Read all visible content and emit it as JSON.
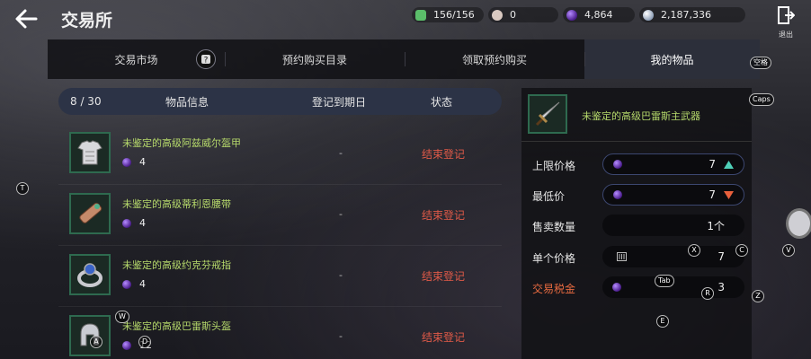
{
  "header": {
    "title": "交易所",
    "exit_label": "退出"
  },
  "currencies": [
    {
      "icon": "weight-icon",
      "value": "156/156",
      "color": "#5bbd6a"
    },
    {
      "icon": "pearl-icon",
      "value": "0",
      "color": "#d9c9c1"
    },
    {
      "icon": "purple-gem-icon",
      "value": "4,864",
      "color": "#7a3cd0"
    },
    {
      "icon": "silver-coin-icon",
      "value": "2,187,336",
      "color": "#c9d6e6"
    }
  ],
  "tabs": [
    {
      "label": "交易市场",
      "active": false
    },
    {
      "label": "预约购买目录",
      "active": false
    },
    {
      "label": "领取预约购买",
      "active": false
    },
    {
      "label": "我的物品",
      "active": true
    }
  ],
  "list": {
    "count": "8 / 30",
    "columns": [
      "物品信息",
      "登记到期日",
      "状态"
    ],
    "items": [
      {
        "name": "未鉴定的高级阿兹威尔盔甲",
        "qty": "4",
        "date": "-",
        "status": "结束登记",
        "icon": "armor-icon"
      },
      {
        "name": "未鉴定的高级蒂利恩腰带",
        "qty": "4",
        "date": "-",
        "status": "结束登记",
        "icon": "belt-icon"
      },
      {
        "name": "未鉴定的高级约克芬戒指",
        "qty": "4",
        "date": "-",
        "status": "结束登记",
        "icon": "ring-icon"
      },
      {
        "name": "未鉴定的高级巴雷斯头盔",
        "qty": "12",
        "date": "-",
        "status": "结束登记",
        "icon": "helmet-icon"
      }
    ]
  },
  "detail": {
    "name": "未鉴定的高级巴雷斯主武器",
    "max_price_label": "上限价格",
    "max_price": "7",
    "min_price_label": "最低价",
    "min_price": "7",
    "quantity_label": "售卖数量",
    "quantity": "1个",
    "unit_price_label": "单个价格",
    "unit_price": "7",
    "tax_label": "交易税金",
    "tax": "3"
  },
  "overlay_keys": [
    "空格",
    "Caps",
    "T",
    "X",
    "C",
    "V",
    "Tab",
    "R",
    "Z",
    "E",
    "W",
    "A",
    "D"
  ],
  "colors": {
    "item_name": "#b6d96b",
    "status": "#e05a48",
    "tax_label": "#e86a40",
    "active_tab": "#2c2f3a"
  }
}
